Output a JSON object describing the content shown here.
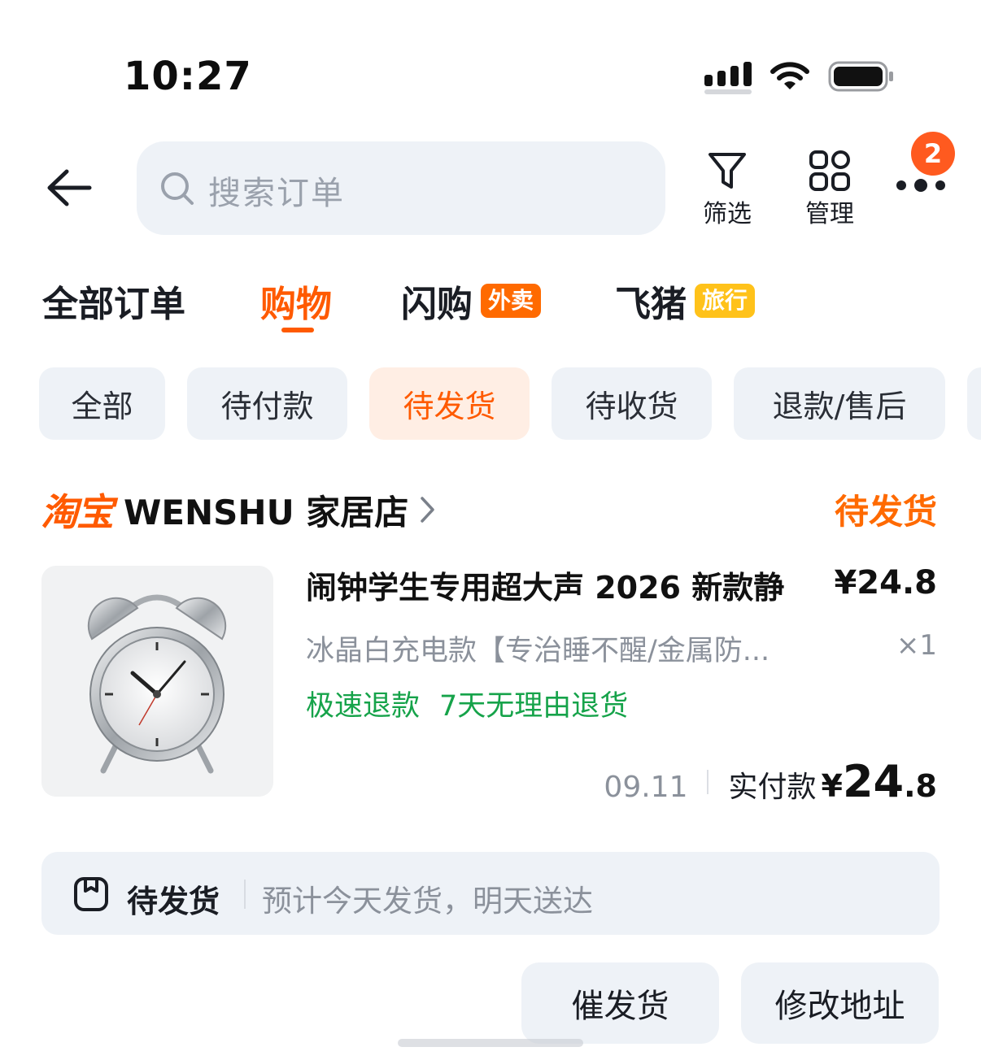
{
  "status_bar": {
    "time": "10:27",
    "icons": [
      "cellular-signal-icon",
      "wifi-icon",
      "battery-icon"
    ]
  },
  "header": {
    "back_icon": "arrow-left-icon",
    "search_placeholder": "搜索订单",
    "filter_label": "筛选",
    "manage_label": "管理",
    "more_icon": "more-dots-icon",
    "notification_count": "2"
  },
  "main_tabs": [
    {
      "label": "全部订单",
      "tag": ""
    },
    {
      "label": "购物",
      "tag": "",
      "active": true
    },
    {
      "label": "闪购",
      "tag": "外卖"
    },
    {
      "label": "飞猪",
      "tag": "旅行"
    }
  ],
  "filter_chips": [
    "全部",
    "待付款",
    "待发货",
    "待收货",
    "退款/售后"
  ],
  "active_chip": "待发货",
  "order": {
    "platform": "淘宝",
    "shop_name": "WENSHU 家居店",
    "status": "待发货",
    "product": {
      "title": "闹钟学生专用超大声 2026 新款静",
      "price": "¥24.8",
      "spec": "冰晶白充电款【专治睡不醒/金属防...",
      "quantity": "×1",
      "service_tags": [
        "极速退款",
        "7天无理由退货"
      ]
    },
    "date": "09.11",
    "paid_label": "实付款",
    "paid_currency": "¥",
    "paid_integer": "24",
    "paid_decimal": ".8",
    "shipping": {
      "status": "待发货",
      "message": "预计今天发货，明天送达"
    },
    "actions": [
      "催发货",
      "修改地址"
    ]
  },
  "colors": {
    "accent": "#ff5a00",
    "service_green": "#16a34a",
    "badge": "#ff5a1f",
    "tag_yellow": "#ffc21a"
  }
}
